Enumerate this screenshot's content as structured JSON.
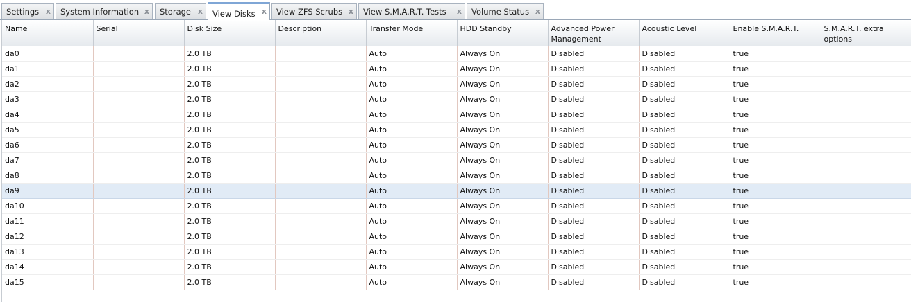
{
  "tabs": [
    {
      "label": "Settings",
      "close": "x"
    },
    {
      "label": "System Information",
      "close": "x"
    },
    {
      "label": "Storage",
      "close": "x"
    },
    {
      "label": "View Disks",
      "close": "x"
    },
    {
      "label": "View ZFS Scrubs",
      "close": "x"
    },
    {
      "label": "View S.M.A.R.T. Tests",
      "close": "x"
    },
    {
      "label": "Volume Status",
      "close": "x"
    }
  ],
  "active_tab": "View Disks",
  "table": {
    "columns": [
      "Name",
      "Serial",
      "Disk Size",
      "Description",
      "Transfer Mode",
      "HDD Standby",
      "Advanced Power Management",
      "Acoustic Level",
      "Enable S.M.A.R.T.",
      "S.M.A.R.T. extra options"
    ],
    "selected_row": "da9",
    "rows": [
      [
        "da0",
        "",
        "2.0 TB",
        "",
        "Auto",
        "Always On",
        "Disabled",
        "Disabled",
        "true",
        ""
      ],
      [
        "da1",
        "",
        "2.0 TB",
        "",
        "Auto",
        "Always On",
        "Disabled",
        "Disabled",
        "true",
        ""
      ],
      [
        "da2",
        "",
        "2.0 TB",
        "",
        "Auto",
        "Always On",
        "Disabled",
        "Disabled",
        "true",
        ""
      ],
      [
        "da3",
        "",
        "2.0 TB",
        "",
        "Auto",
        "Always On",
        "Disabled",
        "Disabled",
        "true",
        ""
      ],
      [
        "da4",
        "",
        "2.0 TB",
        "",
        "Auto",
        "Always On",
        "Disabled",
        "Disabled",
        "true",
        ""
      ],
      [
        "da5",
        "",
        "2.0 TB",
        "",
        "Auto",
        "Always On",
        "Disabled",
        "Disabled",
        "true",
        ""
      ],
      [
        "da6",
        "",
        "2.0 TB",
        "",
        "Auto",
        "Always On",
        "Disabled",
        "Disabled",
        "true",
        ""
      ],
      [
        "da7",
        "",
        "2.0 TB",
        "",
        "Auto",
        "Always On",
        "Disabled",
        "Disabled",
        "true",
        ""
      ],
      [
        "da8",
        "",
        "2.0 TB",
        "",
        "Auto",
        "Always On",
        "Disabled",
        "Disabled",
        "true",
        ""
      ],
      [
        "da9",
        "",
        "2.0 TB",
        "",
        "Auto",
        "Always On",
        "Disabled",
        "Disabled",
        "true",
        ""
      ],
      [
        "da10",
        "",
        "2.0 TB",
        "",
        "Auto",
        "Always On",
        "Disabled",
        "Disabled",
        "true",
        ""
      ],
      [
        "da11",
        "",
        "2.0 TB",
        "",
        "Auto",
        "Always On",
        "Disabled",
        "Disabled",
        "true",
        ""
      ],
      [
        "da12",
        "",
        "2.0 TB",
        "",
        "Auto",
        "Always On",
        "Disabled",
        "Disabled",
        "true",
        ""
      ],
      [
        "da13",
        "",
        "2.0 TB",
        "",
        "Auto",
        "Always On",
        "Disabled",
        "Disabled",
        "true",
        ""
      ],
      [
        "da14",
        "",
        "2.0 TB",
        "",
        "Auto",
        "Always On",
        "Disabled",
        "Disabled",
        "true",
        ""
      ],
      [
        "da15",
        "",
        "2.0 TB",
        "",
        "Auto",
        "Always On",
        "Disabled",
        "Disabled",
        "true",
        ""
      ]
    ]
  },
  "colors": {
    "active_tab_accent": "#7fa6d6",
    "selected_row_bg": "#e1ebf6"
  }
}
